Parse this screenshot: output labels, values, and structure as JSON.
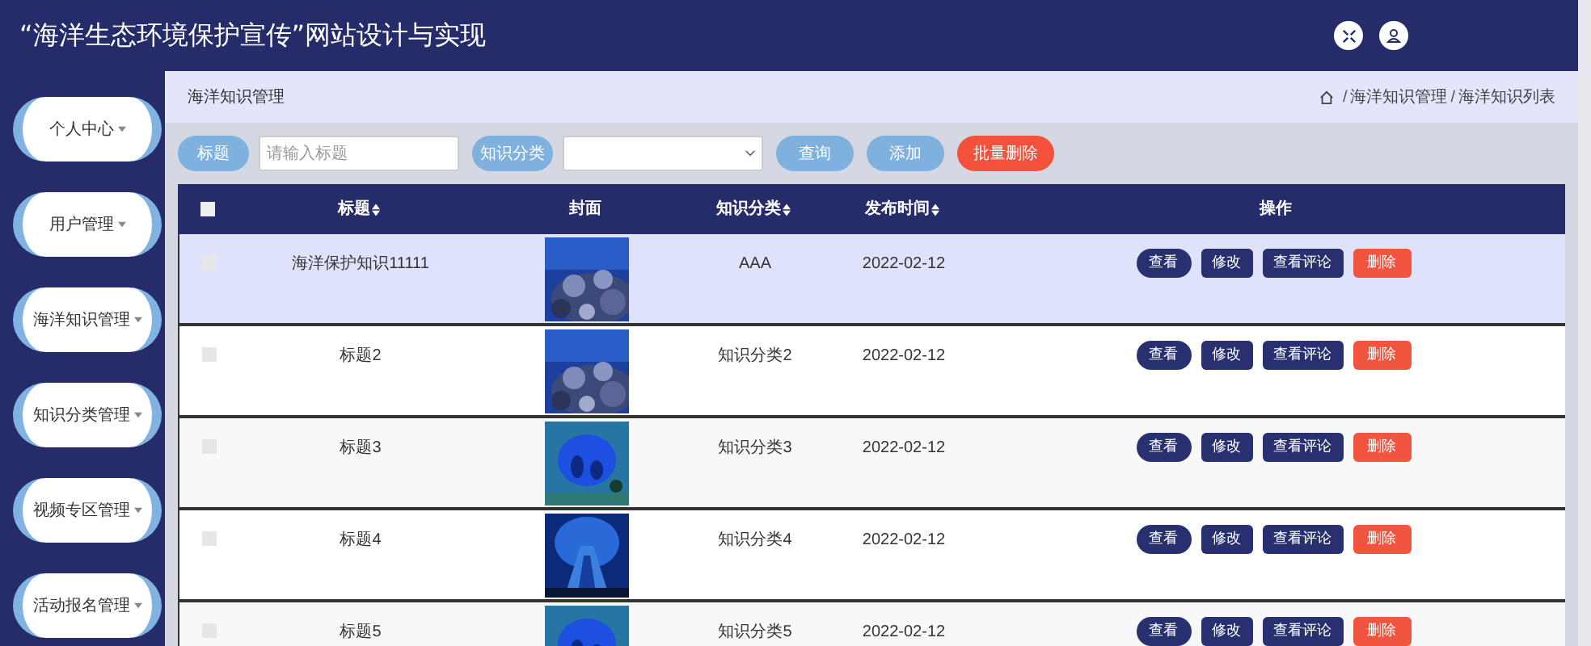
{
  "header": {
    "title": "“海洋生态环境保护宣传”网站设计与实现"
  },
  "sidebar": {
    "items": [
      {
        "label": "个人中心"
      },
      {
        "label": "用户管理"
      },
      {
        "label": "海洋知识管理"
      },
      {
        "label": "知识分类管理"
      },
      {
        "label": "视频专区管理"
      },
      {
        "label": "活动报名管理"
      }
    ]
  },
  "page_title": "海洋知识管理",
  "breadcrumb": [
    "海洋知识管理",
    "海洋知识列表"
  ],
  "breadcrumb_separator": "/",
  "toolbar": {
    "title_label": "标题",
    "title_placeholder": "请输入标题",
    "category_label": "知识分类",
    "buttons": [
      {
        "label": "查询",
        "kind": "primary"
      },
      {
        "label": "添加",
        "kind": "primary"
      },
      {
        "label": "批量删除",
        "kind": "danger"
      }
    ]
  },
  "table": {
    "select_all_checked": false,
    "columns": [
      {
        "label": "标题",
        "sortable": true
      },
      {
        "label": "封面",
        "sortable": false
      },
      {
        "label": "知识分类",
        "sortable": true
      },
      {
        "label": "发布时间",
        "sortable": true
      },
      {
        "label": "操作",
        "sortable": false
      }
    ],
    "rows": [
      {
        "title": "海洋保护知识11111",
        "category": "AAA",
        "date": "2022-02-12",
        "checked": false,
        "hovered": true,
        "actions": [
          {
            "label": "查看",
            "kind": "pill"
          },
          {
            "label": "修改",
            "kind": "dark"
          },
          {
            "label": "查看评论",
            "kind": "dark"
          },
          {
            "label": "删除",
            "kind": "danger"
          }
        ]
      },
      {
        "title": "标题2",
        "category": "知识分类2",
        "date": "2022-02-12",
        "checked": false,
        "hovered": false,
        "actions": [
          {
            "label": "查看",
            "kind": "pill"
          },
          {
            "label": "修改",
            "kind": "dark"
          },
          {
            "label": "查看评论",
            "kind": "dark"
          },
          {
            "label": "删除",
            "kind": "danger"
          }
        ]
      },
      {
        "title": "标题3",
        "category": "知识分类3",
        "date": "2022-02-12",
        "checked": false,
        "hovered": false,
        "actions": [
          {
            "label": "查看",
            "kind": "pill"
          },
          {
            "label": "修改",
            "kind": "dark"
          },
          {
            "label": "查看评论",
            "kind": "dark"
          },
          {
            "label": "删除",
            "kind": "danger"
          }
        ]
      },
      {
        "title": "标题4",
        "category": "知识分类4",
        "date": "2022-02-12",
        "checked": false,
        "hovered": false,
        "actions": [
          {
            "label": "查看",
            "kind": "pill"
          },
          {
            "label": "修改",
            "kind": "dark"
          },
          {
            "label": "查看评论",
            "kind": "dark"
          },
          {
            "label": "删除",
            "kind": "danger"
          }
        ]
      },
      {
        "title": "标题5",
        "category": "知识分类5",
        "date": "2022-02-12",
        "checked": false,
        "hovered": false,
        "actions": [
          {
            "label": "查看",
            "kind": "pill"
          },
          {
            "label": "修改",
            "kind": "dark"
          },
          {
            "label": "查看评论",
            "kind": "dark"
          },
          {
            "label": "删除",
            "kind": "danger"
          }
        ]
      }
    ]
  }
}
